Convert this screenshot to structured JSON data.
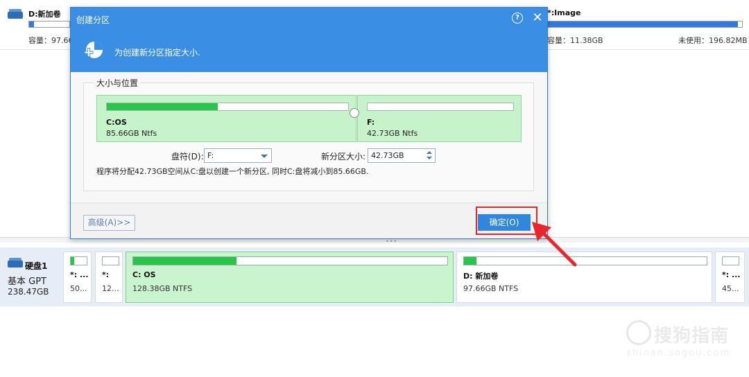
{
  "top_volumes": {
    "left": {
      "name": "D:新加卷",
      "capacity_label": "容量：97.66",
      "used_fraction": 0.12
    },
    "right": {
      "name": "*:Image",
      "capacity_label": "容量：11.38GB",
      "unused_label": "未使用：196.82MB",
      "used_fraction": 0.98
    }
  },
  "dialog": {
    "title": "创建分区",
    "help_icon": "?",
    "close_icon": "✕",
    "header_text": "为创建新分区指定大小.",
    "group_label": "大小与位置",
    "partitions": [
      {
        "name": "C:OS",
        "info": "85.66GB Ntfs",
        "used_fraction": 0.46
      },
      {
        "name": "F:",
        "info": "42.73GB Ntfs",
        "used_fraction": 0
      }
    ],
    "drive_letter_label": "盘符(D):",
    "drive_letter_value": "F:",
    "size_label": "新分区大小:",
    "size_value": "42.73GB",
    "note": "程序将分配42.73GB空间从C:盘以创建一个新分区, 同时C:盘将减小到85.66GB.",
    "advanced_button": "高级(A)>>",
    "ok_button": "确定(O)"
  },
  "disk": {
    "name": "硬盘1",
    "type": "基本 GPT",
    "size": "238.47GB",
    "partitions": [
      {
        "name": "*: ...",
        "info": "50...",
        "used_fraction": 0.2
      },
      {
        "name": "*:",
        "info": "12...",
        "used_fraction": 0
      },
      {
        "name": "C: OS",
        "info": "128.38GB NTFS",
        "used_fraction": 0.33,
        "selected": true
      },
      {
        "name": "D: 新加卷",
        "info": "97.66GB NTFS",
        "used_fraction": 0.05
      },
      {
        "name": "*: ...",
        "info": "45...",
        "used_fraction": 0
      }
    ]
  },
  "watermark": {
    "text": "搜狗指南",
    "url": "zhinan.sogou.com"
  },
  "colors": {
    "accent": "#3a8fe4",
    "partition_fill": "#27c54a",
    "selected_bg": "#c9f4cd",
    "highlight": "#e8262b"
  }
}
